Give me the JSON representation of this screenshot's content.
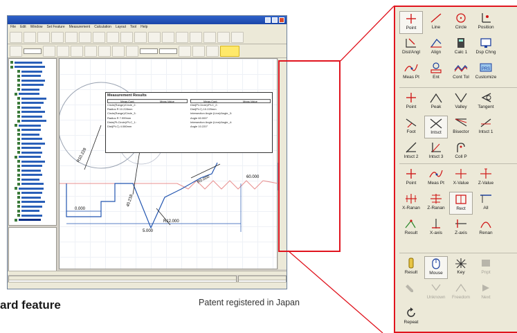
{
  "screenshot": {
    "title": "",
    "menu": [
      "File",
      "Edit",
      "Window",
      "Set Feature",
      "Measurement",
      "Calculation",
      "Layout",
      "Tool",
      "Help"
    ],
    "results_title": "Measurement Results",
    "results_header": [
      "Meas.Cont.",
      "Meas.Value"
    ],
    "results_left": [
      "Circle(Range)/Circle_2:",
      "Radius       R   10.228mm",
      "Circle(Range)/Circle_3:",
      "Radius       R   7.999mm",
      "Distn(Pt-Circle)/Pt-C_1:",
      "Dist(Pt-C)   4.080mm"
    ],
    "results_right": [
      "Dist(Pt-Circle)/Pt-C_2:",
      "Dist(Pt-C)   10.229mm",
      "Intersection Angle (Line)/Angle_3:",
      "Angle        60.000°",
      "Intersection Angle (Line)/Angle_4:",
      "Angle        10.220°"
    ],
    "dim_labels": [
      "R10.228",
      "0.000",
      "40.218",
      "R12.000",
      "5.000",
      "R0.000",
      "60.000"
    ],
    "highlight_button": ""
  },
  "palette": {
    "groups": [
      {
        "id": "element",
        "rows": 3,
        "buttons": [
          {
            "label": "Point",
            "icon": "point-icon",
            "on": true
          },
          {
            "label": "Line",
            "icon": "line-icon"
          },
          {
            "label": "Circle",
            "icon": "circle-icon"
          },
          {
            "label": "Position",
            "icon": "position-icon"
          },
          {
            "label": "Dist/Angl",
            "icon": "dist-angle-icon"
          },
          {
            "label": "Align",
            "icon": "align-icon"
          },
          {
            "label": "Calc 1",
            "icon": "calculator-icon"
          },
          {
            "label": "Dsp Chng",
            "icon": "display-change-icon"
          },
          {
            "label": "Meas Pt",
            "icon": "measure-point-icon"
          },
          {
            "label": "Ent",
            "icon": "entity-icon"
          },
          {
            "label": "Cont Tol",
            "icon": "contour-tolerance-icon"
          },
          {
            "label": "Customize",
            "icon": "customize-icon"
          }
        ]
      },
      {
        "id": "point",
        "rows": 3,
        "buttons": [
          {
            "label": "Point",
            "icon": "point-icon"
          },
          {
            "label": "Peak",
            "icon": "peak-icon"
          },
          {
            "label": "Valley",
            "icon": "valley-icon"
          },
          {
            "label": "Tangent",
            "icon": "tangent-icon"
          },
          {
            "label": "Foot",
            "icon": "foot-icon"
          },
          {
            "label": "Intsct",
            "icon": "intersect-icon",
            "on": true
          },
          {
            "label": "Bisector",
            "icon": "bisector-icon"
          },
          {
            "label": "Intsct 1",
            "icon": "intersect-1-icon"
          },
          {
            "label": "Intsct 2",
            "icon": "intersect-2-icon"
          },
          {
            "label": "Intsct 3",
            "icon": "intersect-3-icon"
          },
          {
            "label": "Coll P",
            "icon": "collect-point-icon"
          }
        ]
      },
      {
        "id": "set",
        "rows": 3,
        "buttons": [
          {
            "label": "Point",
            "icon": "point-icon"
          },
          {
            "label": "Meas Pt",
            "icon": "measure-point-icon"
          },
          {
            "label": "X-Value",
            "icon": "x-value-icon"
          },
          {
            "label": "Z-Value",
            "icon": "z-value-icon"
          },
          {
            "label": "X-Ranan",
            "icon": "x-range-icon"
          },
          {
            "label": "Z-Ranan",
            "icon": "z-range-icon"
          },
          {
            "label": "Rect",
            "icon": "rect-icon",
            "on": true
          },
          {
            "label": "All",
            "icon": "all-icon"
          },
          {
            "label": "Result",
            "icon": "result-icon"
          },
          {
            "label": "X-axis",
            "icon": "x-axis-icon"
          },
          {
            "label": "Z-axis",
            "icon": "z-axis-icon"
          },
          {
            "label": "Renan",
            "icon": "range-icon"
          }
        ]
      },
      {
        "id": "input",
        "rows": 3,
        "buttons": [
          {
            "label": "Result",
            "icon": "result-input-icon"
          },
          {
            "label": "Mouse",
            "icon": "mouse-icon",
            "on": true
          },
          {
            "label": "Key",
            "icon": "key-icon"
          },
          {
            "label": "Pnpt",
            "icon": "pnpt-icon",
            "dis": true
          },
          {
            "label": "",
            "icon": "stylus-icon",
            "dis": true
          },
          {
            "label": "Unknown",
            "icon": "unknown-icon",
            "dis": true
          },
          {
            "label": "Freedom",
            "icon": "freedom-icon",
            "dis": true
          },
          {
            "label": "Next",
            "icon": "next-icon",
            "dis": true
          },
          {
            "label": "Repeat",
            "icon": "repeat-icon"
          }
        ]
      }
    ]
  },
  "caption": {
    "feature": "ard feature",
    "patent": "Patent registered in Japan"
  },
  "colors": {
    "callout": "#e0141e",
    "palette_bg": "#ece9d8"
  }
}
